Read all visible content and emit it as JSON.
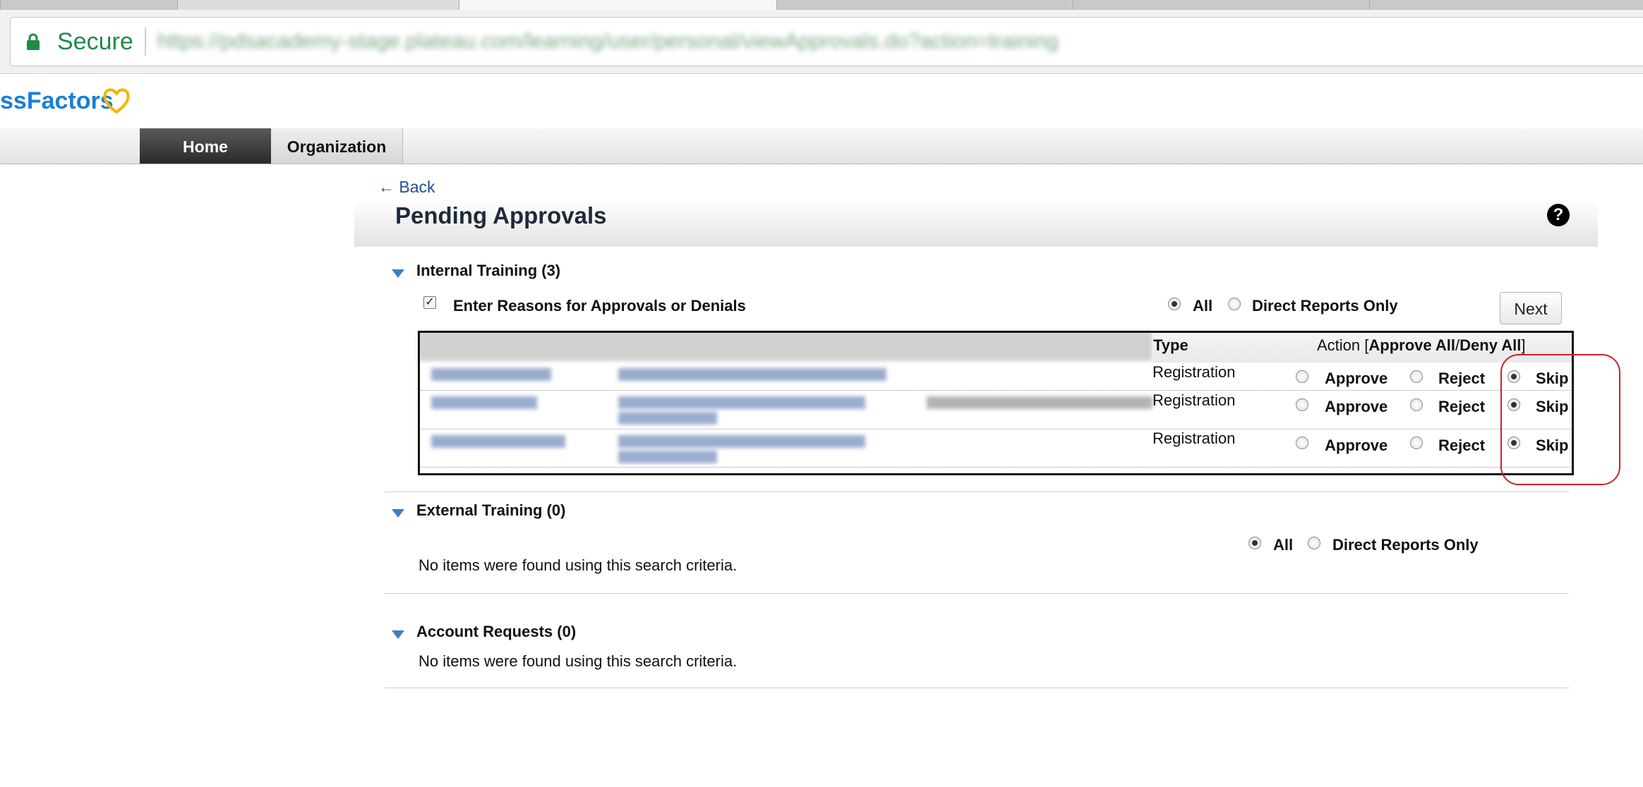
{
  "browser": {
    "secure_label": "Secure",
    "url": "https://pdsacademy-stage.plateau.com/learning/user/personal/viewApprovals.do?action=training"
  },
  "logo": {
    "text": "ssFactors"
  },
  "nav": {
    "home": "Home",
    "organization": "Organization"
  },
  "page": {
    "back_label": "← Back",
    "title": "Pending Approvals",
    "help_icon": "?"
  },
  "internal_training": {
    "title": "Internal Training (3)",
    "reasons_checkbox_label": "Enter Reasons for Approvals or Denials",
    "reasons_checked": true,
    "filter_all": "All",
    "filter_direct": "Direct Reports Only",
    "filter_selected": "All",
    "next_button": "Next",
    "columns": {
      "type": "Type",
      "action_prefix": "Action [",
      "approve_all": "Approve All",
      "slash": "/",
      "deny_all": "Deny All",
      "action_suffix": "]"
    },
    "rows": [
      {
        "type": "Registration",
        "approve": "Approve",
        "reject": "Reject",
        "skip": "Skip",
        "selected": "Skip"
      },
      {
        "type": "Registration",
        "approve": "Approve",
        "reject": "Reject",
        "skip": "Skip",
        "selected": "Skip"
      },
      {
        "type": "Registration",
        "approve": "Approve",
        "reject": "Reject",
        "skip": "Skip",
        "selected": "Skip"
      }
    ]
  },
  "external_training": {
    "title": "External Training (0)",
    "filter_all": "All",
    "filter_direct": "Direct Reports Only",
    "filter_selected": "All",
    "empty_message": "No items were found using this search criteria."
  },
  "account_requests": {
    "title": "Account Requests (0)",
    "empty_message": "No items were found using this search criteria."
  },
  "colors": {
    "secure_green": "#1f8a46",
    "link_blue": "#1f4f93",
    "highlight_red": "#d21f26",
    "brand_blue": "#1a7ed8",
    "heart_gold": "#f5b400"
  }
}
